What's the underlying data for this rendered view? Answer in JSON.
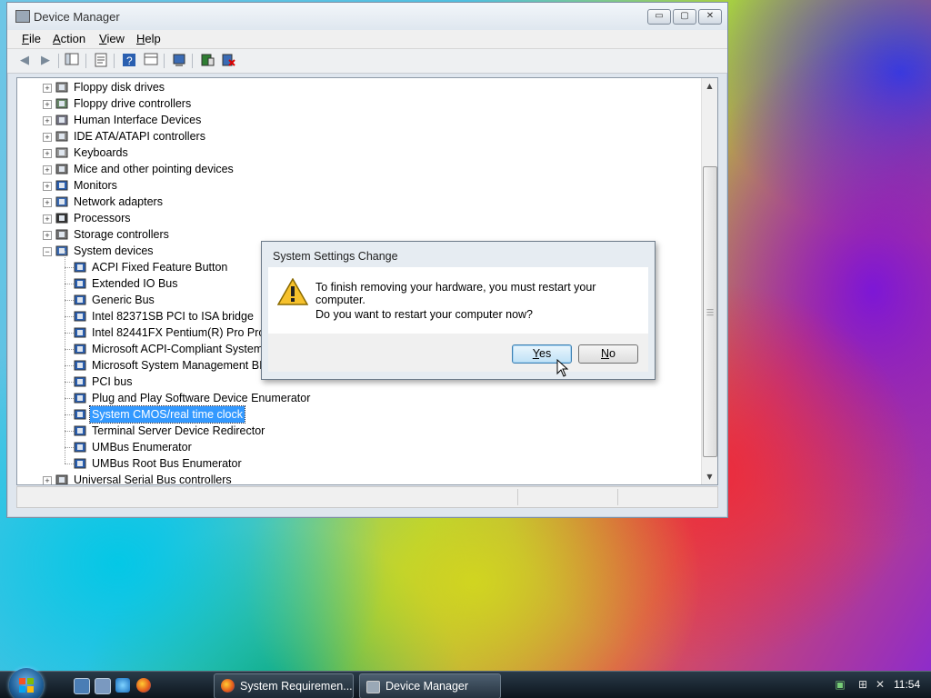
{
  "window": {
    "title": "Device Manager",
    "caption_buttons": {
      "minimize": "▭",
      "maximize": "▢",
      "close": "✕"
    }
  },
  "menu": {
    "file": {
      "hot": "F",
      "rest": "ile"
    },
    "action": {
      "hot": "A",
      "rest": "ction"
    },
    "view": {
      "hot": "V",
      "rest": "iew"
    },
    "help": {
      "hot": "H",
      "rest": "elp"
    }
  },
  "tree": {
    "categories_top": [
      "Floppy disk drives",
      "Floppy drive controllers",
      "Human Interface Devices",
      "IDE ATA/ATAPI controllers",
      "Keyboards",
      "Mice and other pointing devices",
      "Monitors",
      "Network adapters",
      "Processors",
      "Storage controllers",
      "System devices"
    ],
    "system_devices": [
      "ACPI Fixed Feature Button",
      "Extended IO Bus",
      "Generic Bus",
      "Intel 82371SB PCI to ISA bridge",
      "Intel 82441FX Pentium(R) Pro Processor to PCI bridge",
      "Microsoft ACPI-Compliant System",
      "Microsoft System Management BIOS Driver",
      "PCI bus",
      "Plug and Play Software Device Enumerator",
      "System CMOS/real time clock",
      "Terminal Server Device Redirector",
      "UMBus Enumerator",
      "UMBus Root Bus Enumerator"
    ],
    "selected": "System CMOS/real time clock",
    "categories_bottom": [
      "Universal Serial Bus controllers"
    ]
  },
  "dialog": {
    "title": "System Settings Change",
    "message": "To finish removing your hardware, you must restart your computer.",
    "question": "Do you want to restart your computer now?",
    "yes": {
      "hot": "Y",
      "rest": "es"
    },
    "no": {
      "hot": "N",
      "rest": "o"
    }
  },
  "taskbar": {
    "tasks": [
      "System Requiremen...",
      "Device Manager"
    ],
    "clock": "11:54"
  },
  "colors": {
    "selection": "#3399ff",
    "accent": "#3c7fb1"
  }
}
